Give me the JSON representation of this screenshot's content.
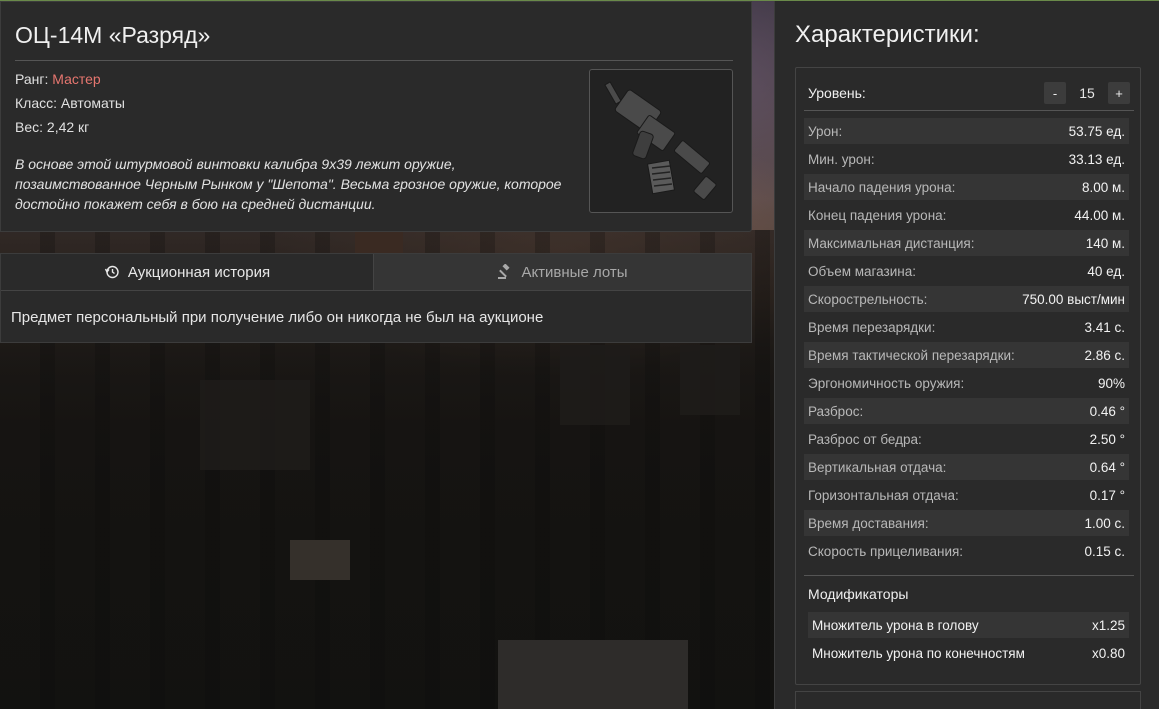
{
  "item": {
    "title": "ОЦ-14М «Разряд»",
    "rank_label": "Ранг: ",
    "rank_value": "Мастер",
    "class_line": "Класс: Автоматы",
    "weight_line": "Вес: 2,42 кг",
    "description": "В основе этой штурмовой винтовки калибра 9х39 лежит оружие, позаимствованное Черным Рынком у \"Шепота\". Весьма грозное оружие, которое достойно покажет себя в бою на средней дистанции.",
    "image_icon": "rifle-icon"
  },
  "tabs": [
    {
      "label": "Аукционная история",
      "icon": "history-icon",
      "active": true
    },
    {
      "label": "Активные лоты",
      "icon": "gavel-icon",
      "active": false
    }
  ],
  "auction_message": "Предмет персональный при получение либо он никогда не был на аукционе",
  "stats": {
    "title": "Характеристики:",
    "level_label": "Уровень:",
    "level_minus": "-",
    "level_value": "15",
    "level_plus": "+",
    "rows": [
      {
        "label": "Урон:",
        "value": "53.75 ед."
      },
      {
        "label": "Мин. урон:",
        "value": "33.13 ед."
      },
      {
        "label": "Начало падения урона:",
        "value": "8.00 м."
      },
      {
        "label": "Конец падения урона:",
        "value": "44.00 м."
      },
      {
        "label": "Максимальная дистанция:",
        "value": "140 м."
      },
      {
        "label": "Объем магазина:",
        "value": "40 ед."
      },
      {
        "label": "Скорострельность:",
        "value": "750.00 выст/мин"
      },
      {
        "label": "Время перезарядки:",
        "value": "3.41 с."
      },
      {
        "label": "Время тактической перезарядки:",
        "value": "2.86 с."
      },
      {
        "label": "Эргономичность оружия:",
        "value": "90%"
      },
      {
        "label": "Разброс:",
        "value": "0.46 °"
      },
      {
        "label": "Разброс от бедра:",
        "value": "2.50 °"
      },
      {
        "label": "Вертикальная отдача:",
        "value": "0.64 °"
      },
      {
        "label": "Горизонтальная отдача:",
        "value": "0.17 °"
      },
      {
        "label": "Время доставания:",
        "value": "1.00 с."
      },
      {
        "label": "Скорость прицеливания:",
        "value": "0.15 с."
      }
    ],
    "modifiers_title": "Модификаторы",
    "modifiers": [
      {
        "label": "Множитель урона в голову",
        "value": "x1.25"
      },
      {
        "label": "Множитель урона по конечностям",
        "value": "x0.80"
      }
    ]
  },
  "colors": {
    "rank": "#e6766f",
    "panel": "#2a2a2a"
  }
}
